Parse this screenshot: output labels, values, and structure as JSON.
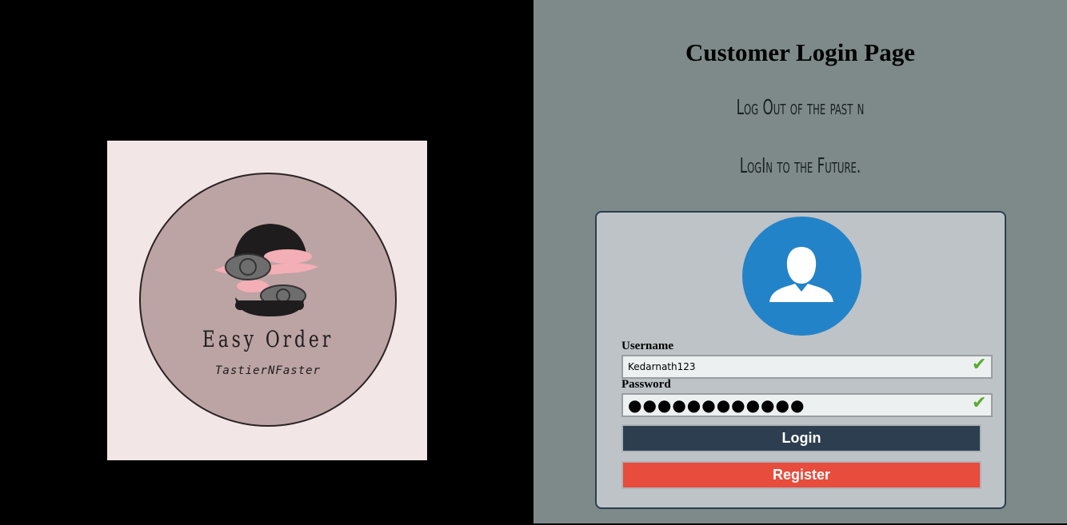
{
  "logo": {
    "brand_name": "Easy Order",
    "tagline": "TastierNFaster"
  },
  "page": {
    "title": "Customer Login Page",
    "tagline_line1": "Log Out of the past n",
    "tagline_line2": "LogIn to the Future."
  },
  "form": {
    "username_label": "Username",
    "username_value": "Kedarnath123",
    "password_label": "Password",
    "password_value": "●●●●●●●●●●●●",
    "valid_icon": "✔",
    "login_label": "Login",
    "register_label": "Register"
  },
  "colors": {
    "left_bg": "#000000",
    "right_bg": "#7e8a8a",
    "box_bg": "#bdc3c7",
    "avatar": "#2383c8",
    "login_btn": "#2c3e50",
    "register_btn": "#e74c3c",
    "valid": "#5aab2e"
  }
}
